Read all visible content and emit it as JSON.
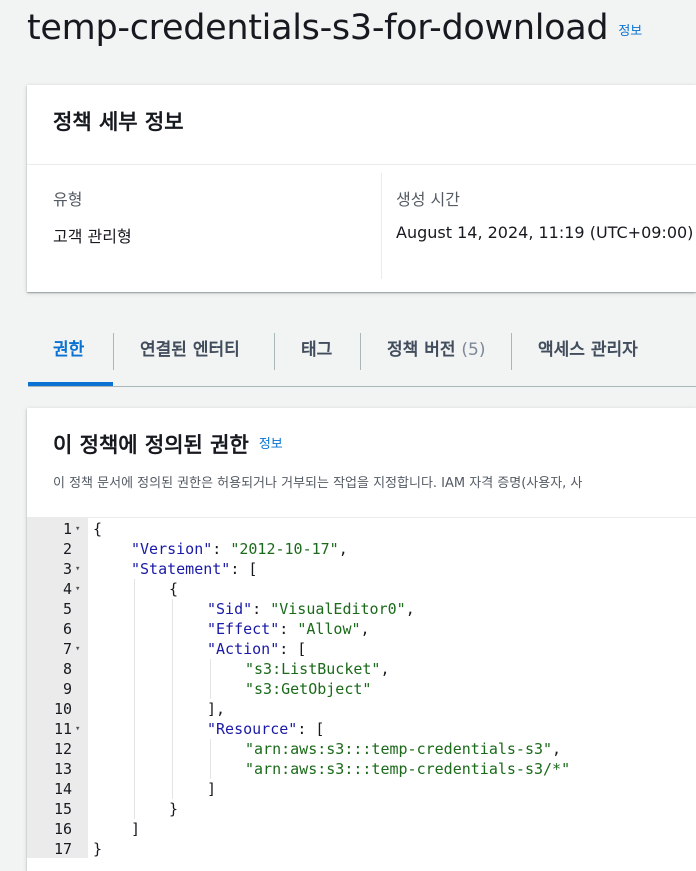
{
  "page": {
    "title": "temp-credentials-s3-for-download",
    "info_label": "정보"
  },
  "details": {
    "header": "정책 세부 정보",
    "type_label": "유형",
    "type_value": "고객 관리형",
    "created_label": "생성 시간",
    "created_value": "August 14, 2024, 11:19 (UTC+09:00)"
  },
  "tabs": [
    {
      "label": "권한",
      "count": ""
    },
    {
      "label": "연결된 엔터티",
      "count": ""
    },
    {
      "label": "태그",
      "count": ""
    },
    {
      "label": "정책 버전",
      "count": "(5)"
    },
    {
      "label": "액세스 관리자",
      "count": ""
    }
  ],
  "permissions": {
    "title": "이 정책에 정의된 권한",
    "info_label": "정보",
    "description": "이 정책 문서에 정의된 권한은 허용되거나 거부되는 작업을 지정합니다. IAM 자격 증명(사용자, 사"
  },
  "editor": {
    "lines": [
      {
        "n": "1",
        "fold": true,
        "indent": 0,
        "key": "",
        "text": "{"
      },
      {
        "n": "2",
        "fold": false,
        "indent": 1,
        "key": "\"Version\"",
        "text": ": \"2012-10-17\","
      },
      {
        "n": "3",
        "fold": true,
        "indent": 1,
        "key": "\"Statement\"",
        "text": ": ["
      },
      {
        "n": "4",
        "fold": true,
        "indent": 2,
        "key": "",
        "text": "{"
      },
      {
        "n": "5",
        "fold": false,
        "indent": 3,
        "key": "\"Sid\"",
        "text": ": \"VisualEditor0\","
      },
      {
        "n": "6",
        "fold": false,
        "indent": 3,
        "key": "\"Effect\"",
        "text": ": \"Allow\","
      },
      {
        "n": "7",
        "fold": true,
        "indent": 3,
        "key": "\"Action\"",
        "text": ": ["
      },
      {
        "n": "8",
        "fold": false,
        "indent": 4,
        "key": "",
        "text": "\"s3:ListBucket\","
      },
      {
        "n": "9",
        "fold": false,
        "indent": 4,
        "key": "",
        "text": "\"s3:GetObject\""
      },
      {
        "n": "10",
        "fold": false,
        "indent": 3,
        "key": "",
        "text": "],"
      },
      {
        "n": "11",
        "fold": true,
        "indent": 3,
        "key": "\"Resource\"",
        "text": ": ["
      },
      {
        "n": "12",
        "fold": false,
        "indent": 4,
        "key": "",
        "text": "\"arn:aws:s3:::temp-credentials-s3\","
      },
      {
        "n": "13",
        "fold": false,
        "indent": 4,
        "key": "",
        "text": "\"arn:aws:s3:::temp-credentials-s3/*\""
      },
      {
        "n": "14",
        "fold": false,
        "indent": 3,
        "key": "",
        "text": "]"
      },
      {
        "n": "15",
        "fold": false,
        "indent": 2,
        "key": "",
        "text": "}"
      },
      {
        "n": "16",
        "fold": false,
        "indent": 1,
        "key": "",
        "text": "]"
      },
      {
        "n": "17",
        "fold": false,
        "indent": 0,
        "key": "",
        "text": "}"
      }
    ]
  }
}
